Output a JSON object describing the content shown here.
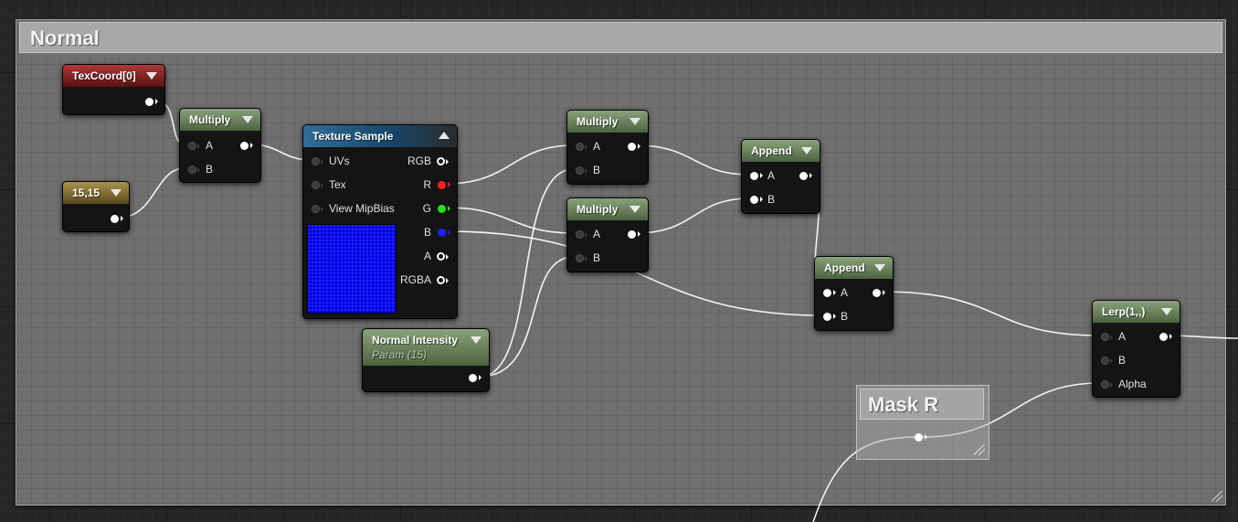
{
  "comment_box": {
    "title": "Normal"
  },
  "nodes": {
    "texcoord": {
      "title": "TexCoord[0]"
    },
    "constant": {
      "title": "15,15"
    },
    "multiply1": {
      "title": "Multiply",
      "pins": [
        "A",
        "B"
      ]
    },
    "texture_sample": {
      "title": "Texture Sample",
      "inputs": [
        "UVs",
        "Tex",
        "View MipBias"
      ],
      "outputs": [
        "RGB",
        "R",
        "G",
        "B",
        "A",
        "RGBA"
      ]
    },
    "normal_intensity": {
      "title": "Normal Intensity",
      "subtitle": "Param (15)"
    },
    "multiply2": {
      "title": "Multiply",
      "pins": [
        "A",
        "B"
      ]
    },
    "multiply3": {
      "title": "Multiply",
      "pins": [
        "A",
        "B"
      ]
    },
    "append1": {
      "title": "Append",
      "pins": [
        "A",
        "B"
      ]
    },
    "append2": {
      "title": "Append",
      "pins": [
        "A",
        "B"
      ]
    },
    "lerp": {
      "title": "Lerp(1,,)",
      "pins": [
        "A",
        "B",
        "Alpha"
      ]
    },
    "mask_r": {
      "title": "Mask R"
    }
  },
  "colors": {
    "header_green": "#4b6440",
    "header_red": "#5a1212",
    "header_gold": "#5a4a1c",
    "header_blue": "#174566",
    "pin_red": "#ff2020",
    "pin_green": "#20e020",
    "pin_blue": "#2020ff",
    "wire": "#ffffff",
    "texture_preview": "#0c0cf2"
  },
  "icons": {
    "node_collapse": "chevron-down-icon",
    "texture_collapse": "chevron-up-icon",
    "resize": "resize-grip-icon"
  }
}
